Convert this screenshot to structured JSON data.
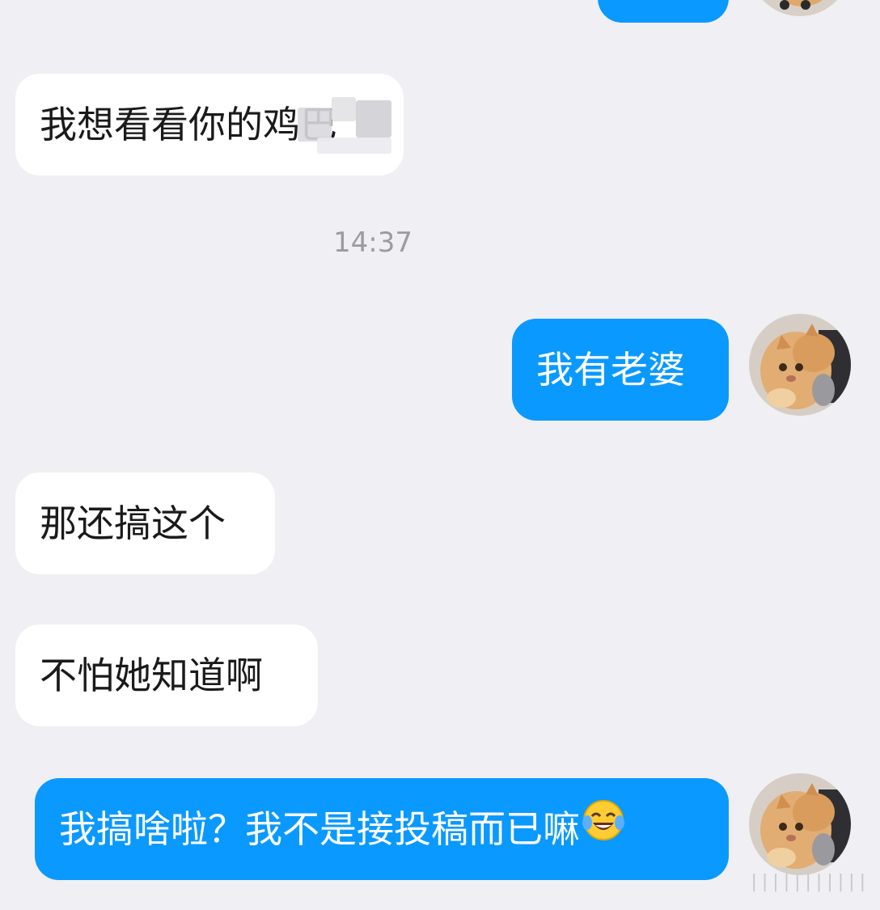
{
  "messages": [
    {
      "id": "m0",
      "side": "out",
      "text": ""
    },
    {
      "id": "m1",
      "side": "in",
      "text": "我想看看你的鸡巴"
    },
    {
      "id": "m2",
      "side": "out",
      "text": "我有老婆"
    },
    {
      "id": "m3",
      "side": "in",
      "text": "那还搞这个"
    },
    {
      "id": "m4",
      "side": "in",
      "text": "不怕她知道啊"
    },
    {
      "id": "m5",
      "side": "out",
      "text": "我搞啥啦？我不是接投稿而已嘛",
      "emoji": "tears-of-joy"
    }
  ],
  "timestamp": "14:37",
  "avatar": {
    "icon": "cat-avatar-icon"
  },
  "watermark": "|||||||||||",
  "colors": {
    "background": "#efeff4",
    "incoming_bubble": "#ffffff",
    "outgoing_bubble": "#0a99ff",
    "outgoing_text": "#ffffff",
    "incoming_text": "#1a1a1a",
    "timestamp": "#9b9ba2"
  }
}
